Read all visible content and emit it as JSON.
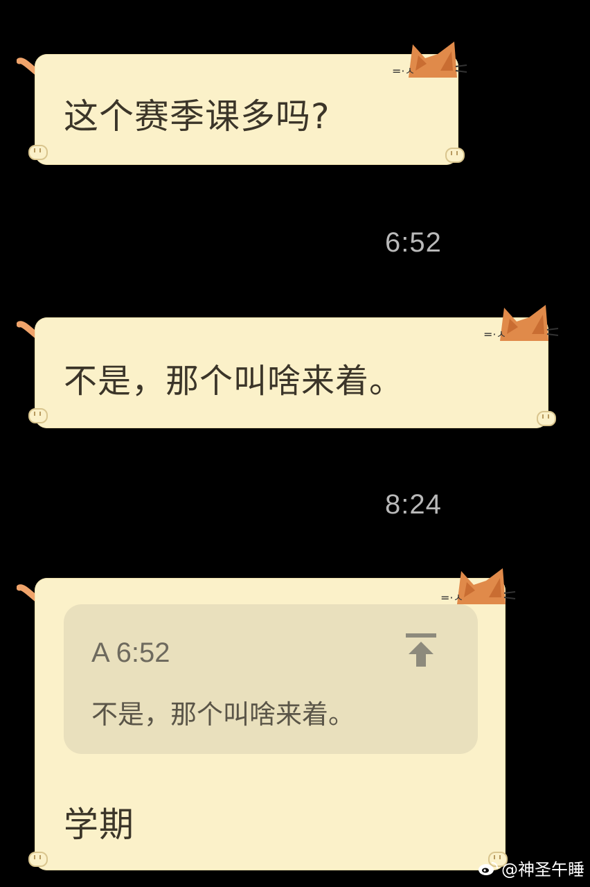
{
  "messages": [
    {
      "text": "这个赛季课多吗?",
      "time": "6:52"
    },
    {
      "text": "不是，那个叫啥来着。",
      "time": "8:24"
    },
    {
      "text": "学期",
      "quote": {
        "sender_time": "A 6:52",
        "text": "不是，那个叫啥来着。"
      }
    }
  ],
  "watermark": "@神圣午睡",
  "colors": {
    "background": "#000000",
    "bubble": "#fbf1c9",
    "quote_box": "#e9e0bd",
    "cat": "#e08a4a",
    "timestamp": "#b9b9b9"
  },
  "icons": [
    "cat-icon",
    "paw-icon",
    "tail-icon",
    "jump-to-top-icon",
    "weibo-logo-icon"
  ]
}
